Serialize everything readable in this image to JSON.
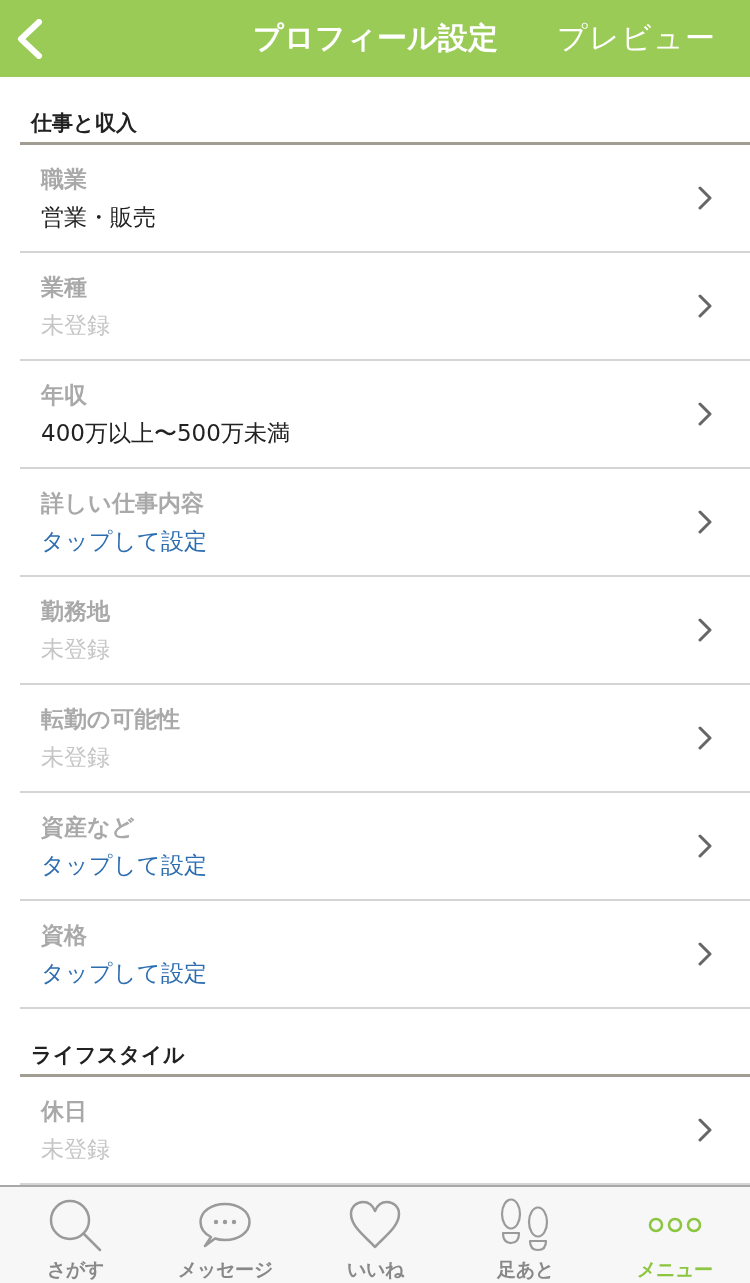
{
  "header": {
    "title": "プロフィール設定",
    "action": "プレビュー"
  },
  "sections": [
    {
      "title": "仕事と収入",
      "items": [
        {
          "label": "職業",
          "value": "営業・販売",
          "kind": "set"
        },
        {
          "label": "業種",
          "value": "未登録",
          "kind": "unset"
        },
        {
          "label": "年収",
          "value": "400万以上〜500万未満",
          "kind": "set"
        },
        {
          "label": "詳しい仕事内容",
          "value": "タップして設定",
          "kind": "prompt"
        },
        {
          "label": "勤務地",
          "value": "未登録",
          "kind": "unset"
        },
        {
          "label": "転勤の可能性",
          "value": "未登録",
          "kind": "unset"
        },
        {
          "label": "資産など",
          "value": "タップして設定",
          "kind": "prompt"
        },
        {
          "label": "資格",
          "value": "タップして設定",
          "kind": "prompt"
        }
      ]
    },
    {
      "title": "ライフスタイル",
      "items": [
        {
          "label": "休日",
          "value": "未登録",
          "kind": "unset"
        }
      ]
    }
  ],
  "tab_bar": [
    {
      "label": "さがす",
      "kind": "search",
      "selected": false
    },
    {
      "label": "メッセージ",
      "kind": "message",
      "selected": false
    },
    {
      "label": "いいね",
      "kind": "like",
      "selected": false
    },
    {
      "label": "足あと",
      "kind": "footprints",
      "selected": false
    },
    {
      "label": "メニュー",
      "kind": "menu",
      "selected": true
    }
  ]
}
